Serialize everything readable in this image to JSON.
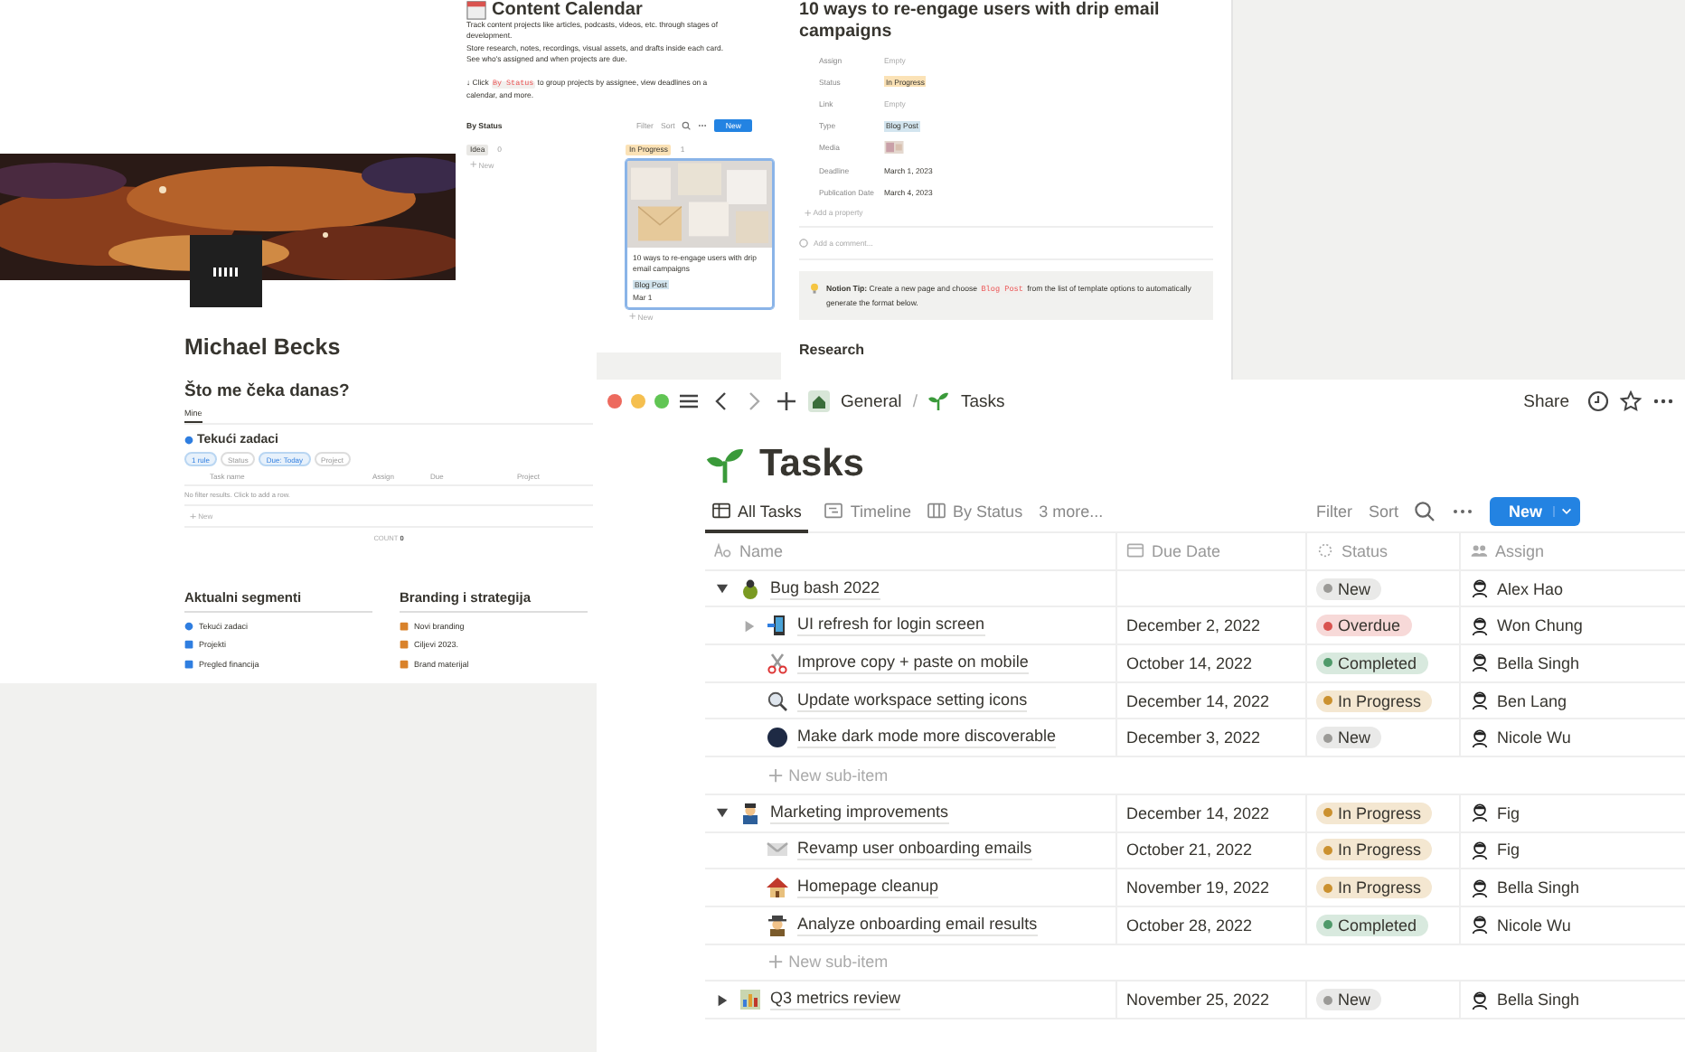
{
  "profile_page": {
    "name": "Michael Becks",
    "heading": "Što me čeka danas?",
    "view_tab": "Mine",
    "database_title": "Tekući zadaci",
    "filters": [
      {
        "label": "1 rule",
        "active": true
      },
      {
        "label": "Status",
        "active": false
      },
      {
        "label": "Due: Today",
        "active": true
      },
      {
        "label": "Project",
        "active": false
      }
    ],
    "columns": [
      "Task name",
      "Assign",
      "Due",
      "Project"
    ],
    "empty_message": "No filter results. Click to add a row.",
    "new_label": "New",
    "count_label": "COUNT",
    "count_value": "0",
    "sections": [
      {
        "title": "Aktualni segmenti",
        "items": [
          "Tekući zadaci",
          "Projekti",
          "Pregled financija"
        ]
      },
      {
        "title": "Branding i strategija",
        "items": [
          "Novi branding",
          "Ciljevi 2023.",
          "Brand materijal"
        ]
      }
    ]
  },
  "content_calendar": {
    "title": "Content Calendar",
    "description": [
      "Track content projects like articles, podcasts, videos, etc. through stages of development.",
      "Store research, notes, recordings, visual assets, and drafts inside each card.",
      "See who's assigned and when projects are due."
    ],
    "hint": {
      "before": "↓ Click",
      "code": "By Status",
      "after": "to group projects by assignee, view deadlines on a calendar, and more."
    },
    "view": "By Status",
    "toolbar": [
      "Filter",
      "Sort"
    ],
    "new_button": "New",
    "columns": [
      {
        "label": "Idea",
        "count": "0",
        "color": "#e9e8e5",
        "new_label": "New"
      },
      {
        "label": "In Progress",
        "count": "1",
        "color": "#fbe2b6",
        "cards": [
          {
            "title": "10 ways to re-engage users with drip email campaigns",
            "tag": "Blog Post",
            "date": "Mar 1",
            "selected": true
          }
        ],
        "new_label": "New"
      }
    ]
  },
  "detail_page": {
    "title": "10 ways to re-engage users with drip email campaigns",
    "properties": [
      {
        "label": "Assign",
        "kind": "empty",
        "value": "Empty"
      },
      {
        "label": "Status",
        "kind": "tag",
        "value": "In Progress",
        "color": "#fbe2b6"
      },
      {
        "label": "Link",
        "kind": "empty",
        "value": "Empty"
      },
      {
        "label": "Type",
        "kind": "tag",
        "value": "Blog Post",
        "color": "#d3e5ef"
      },
      {
        "label": "Media"
      },
      {
        "label": "Deadline",
        "kind": "text",
        "value": "March 1, 2023"
      },
      {
        "label": "Publication Date",
        "kind": "text",
        "value": "March 4, 2023"
      }
    ],
    "add_property": "Add a property",
    "comment_placeholder": "Add a comment...",
    "tip": {
      "label": "Notion Tip:",
      "before": "Create a new page and choose",
      "code": "Blog Post",
      "after": "from the list of template options to automatically generate the format below."
    },
    "section_heading": "Research"
  },
  "tasks_window": {
    "breadcrumb": [
      "General",
      "Tasks"
    ],
    "breadcrumb_separator": "/",
    "share": "Share",
    "title": "Tasks",
    "views": [
      {
        "label": "All Tasks",
        "selected": true
      },
      {
        "label": "Timeline",
        "selected": false
      },
      {
        "label": "By Status",
        "selected": false
      }
    ],
    "more_views": "3 more...",
    "toolbar": [
      "Filter",
      "Sort"
    ],
    "new_button": "New",
    "columns": [
      "Name",
      "Due Date",
      "Status",
      "Assign"
    ],
    "rows": [
      {
        "name": "Bug bash 2022",
        "status": "New",
        "color": "#9b9a97",
        "assignee": "Alex Hao",
        "expanded": true,
        "new_row_label": "New sub-item",
        "children": [
          {
            "name": "UI refresh for login screen",
            "due": "December 2, 2022",
            "status": "Overdue",
            "color": "#d9534f",
            "assignee": "Won Chung",
            "expanded": false
          },
          {
            "name": "Improve copy + paste on mobile",
            "due": "October 14, 2022",
            "status": "Completed",
            "color": "#4f9a6a",
            "assignee": "Bella Singh"
          },
          {
            "name": "Update workspace setting icons",
            "due": "December 14, 2022",
            "status": "In Progress",
            "color": "#cb912f",
            "assignee": "Ben Lang"
          },
          {
            "name": "Make dark mode more discoverable",
            "due": "December 3, 2022",
            "status": "New",
            "color": "#9b9a97",
            "assignee": "Nicole Wu"
          }
        ]
      },
      {
        "name": "Marketing improvements",
        "due": "December 14, 2022",
        "status": "In Progress",
        "color": "#cb912f",
        "assignee": "Fig",
        "expanded": true,
        "new_row_label": "New sub-item",
        "children": [
          {
            "name": "Revamp user onboarding emails",
            "due": "October 21, 2022",
            "status": "In Progress",
            "color": "#cb912f",
            "assignee": "Fig"
          },
          {
            "name": "Homepage cleanup",
            "due": "November 19, 2022",
            "status": "In Progress",
            "color": "#cb912f",
            "assignee": "Bella Singh"
          },
          {
            "name": "Analyze onboarding email results",
            "due": "October 28, 2022",
            "status": "Completed",
            "color": "#4f9a6a",
            "assignee": "Nicole Wu"
          }
        ]
      },
      {
        "name": "Q3 metrics review",
        "due": "November 25, 2022",
        "status": "New",
        "color": "#9b9a97",
        "assignee": "Bella Singh",
        "expanded": false
      }
    ]
  }
}
